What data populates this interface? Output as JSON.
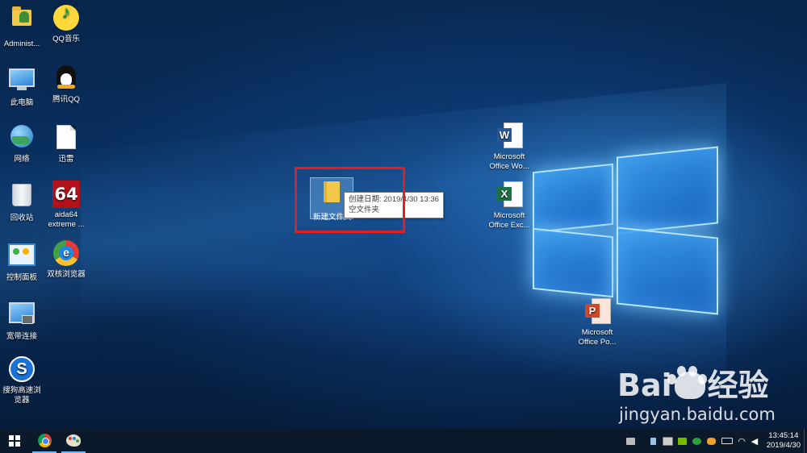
{
  "desktop": {
    "left_icons": [
      {
        "name": "administrator-folder",
        "label": "Administ..."
      },
      {
        "name": "qq-music",
        "label": "QQ音乐"
      },
      {
        "name": "this-pc",
        "label": "此电脑"
      },
      {
        "name": "tencent-qq",
        "label": "腾讯QQ"
      },
      {
        "name": "network",
        "label": "网络"
      },
      {
        "name": "xunlei",
        "label": "迅雷"
      },
      {
        "name": "recycle-bin",
        "label": "回收站"
      },
      {
        "name": "aida64",
        "label": "aida64",
        "label2": "extreme ...",
        "logo": "64"
      },
      {
        "name": "control-panel",
        "label": "控制面板"
      },
      {
        "name": "dual-core-browser",
        "label": "双核浏览器"
      },
      {
        "name": "broadband-connection",
        "label": "宽带连接"
      },
      {
        "name": "sogou-browser",
        "label": "搜狗高速浏",
        "label2": "览器",
        "logo": "S"
      }
    ],
    "office_icons": [
      {
        "name": "office-word",
        "label": "Microsoft",
        "label2": "Office Wo...",
        "badge": "W"
      },
      {
        "name": "office-excel",
        "label": "Microsoft",
        "label2": "Office Exc...",
        "badge": "X"
      },
      {
        "name": "office-powerpoint",
        "label": "Microsoft",
        "label2": "Office Po...",
        "badge": "P"
      }
    ],
    "selected_folder": {
      "label": "新建文件夹"
    },
    "tooltip": {
      "line1": "创建日期: 2019/4/30 13:36",
      "line2": "空文件夹"
    }
  },
  "watermark": {
    "brand_left": "Bai",
    "brand_right": "经验",
    "url": "jingyan.baidu.com"
  },
  "taskbar": {
    "pinned": [
      {
        "name": "chrome",
        "icon": "chrome-icon"
      },
      {
        "name": "paint",
        "icon": "paint-icon"
      }
    ],
    "tray_icons": [
      "printer-icon",
      "usb-icon",
      "storage-icon",
      "nvidia-icon",
      "security-icon",
      "qq-tray-icon",
      "battery-icon",
      "wifi-icon",
      "volume-icon"
    ],
    "clock": {
      "time": "13:45:14",
      "date": "2019/4/30"
    },
    "colors": {
      "taskbar": "#0b1a2a",
      "accent": "#7ab4e8"
    }
  }
}
